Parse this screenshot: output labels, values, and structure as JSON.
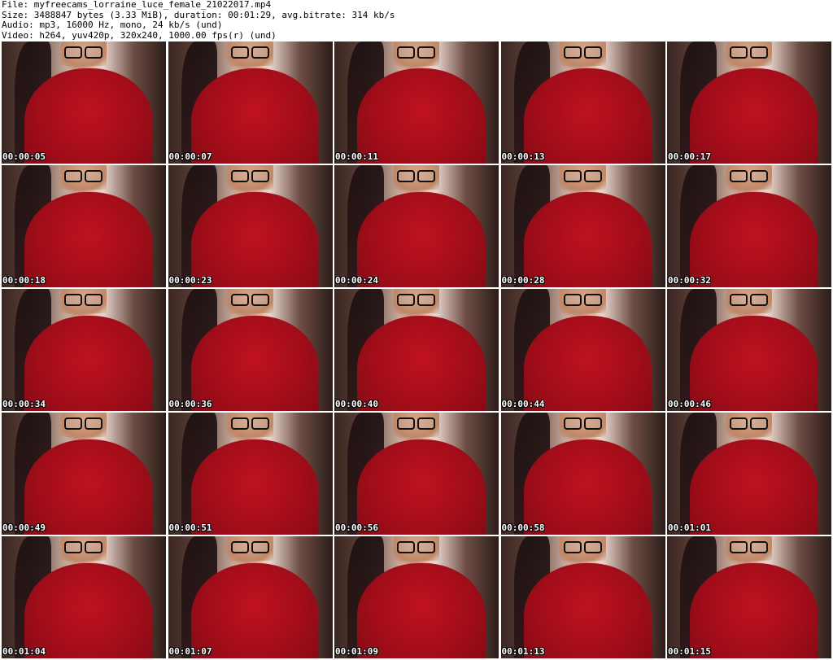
{
  "header": {
    "file_line": "File: myfreecams_lorraine_luce_female_21022017.mp4",
    "size_line": "Size: 3488847 bytes (3.33 MiB), duration: 00:01:29, avg.bitrate: 314 kb/s",
    "audio_line": "Audio: mp3, 16000 Hz, mono, 24 kb/s (und)",
    "video_line": "Video: h264, yuv420p, 320x240, 1000.00 fps(r) (und)"
  },
  "thumbnails": [
    {
      "timestamp": "00:00:05"
    },
    {
      "timestamp": "00:00:07"
    },
    {
      "timestamp": "00:00:11"
    },
    {
      "timestamp": "00:00:13"
    },
    {
      "timestamp": "00:00:17"
    },
    {
      "timestamp": "00:00:18"
    },
    {
      "timestamp": "00:00:23"
    },
    {
      "timestamp": "00:00:24"
    },
    {
      "timestamp": "00:00:28"
    },
    {
      "timestamp": "00:00:32"
    },
    {
      "timestamp": "00:00:34"
    },
    {
      "timestamp": "00:00:36"
    },
    {
      "timestamp": "00:00:40"
    },
    {
      "timestamp": "00:00:44"
    },
    {
      "timestamp": "00:00:46"
    },
    {
      "timestamp": "00:00:49"
    },
    {
      "timestamp": "00:00:51"
    },
    {
      "timestamp": "00:00:56"
    },
    {
      "timestamp": "00:00:58"
    },
    {
      "timestamp": "00:01:01"
    },
    {
      "timestamp": "00:01:04"
    },
    {
      "timestamp": "00:01:07"
    },
    {
      "timestamp": "00:01:09"
    },
    {
      "timestamp": "00:01:13"
    },
    {
      "timestamp": "00:01:15"
    }
  ]
}
